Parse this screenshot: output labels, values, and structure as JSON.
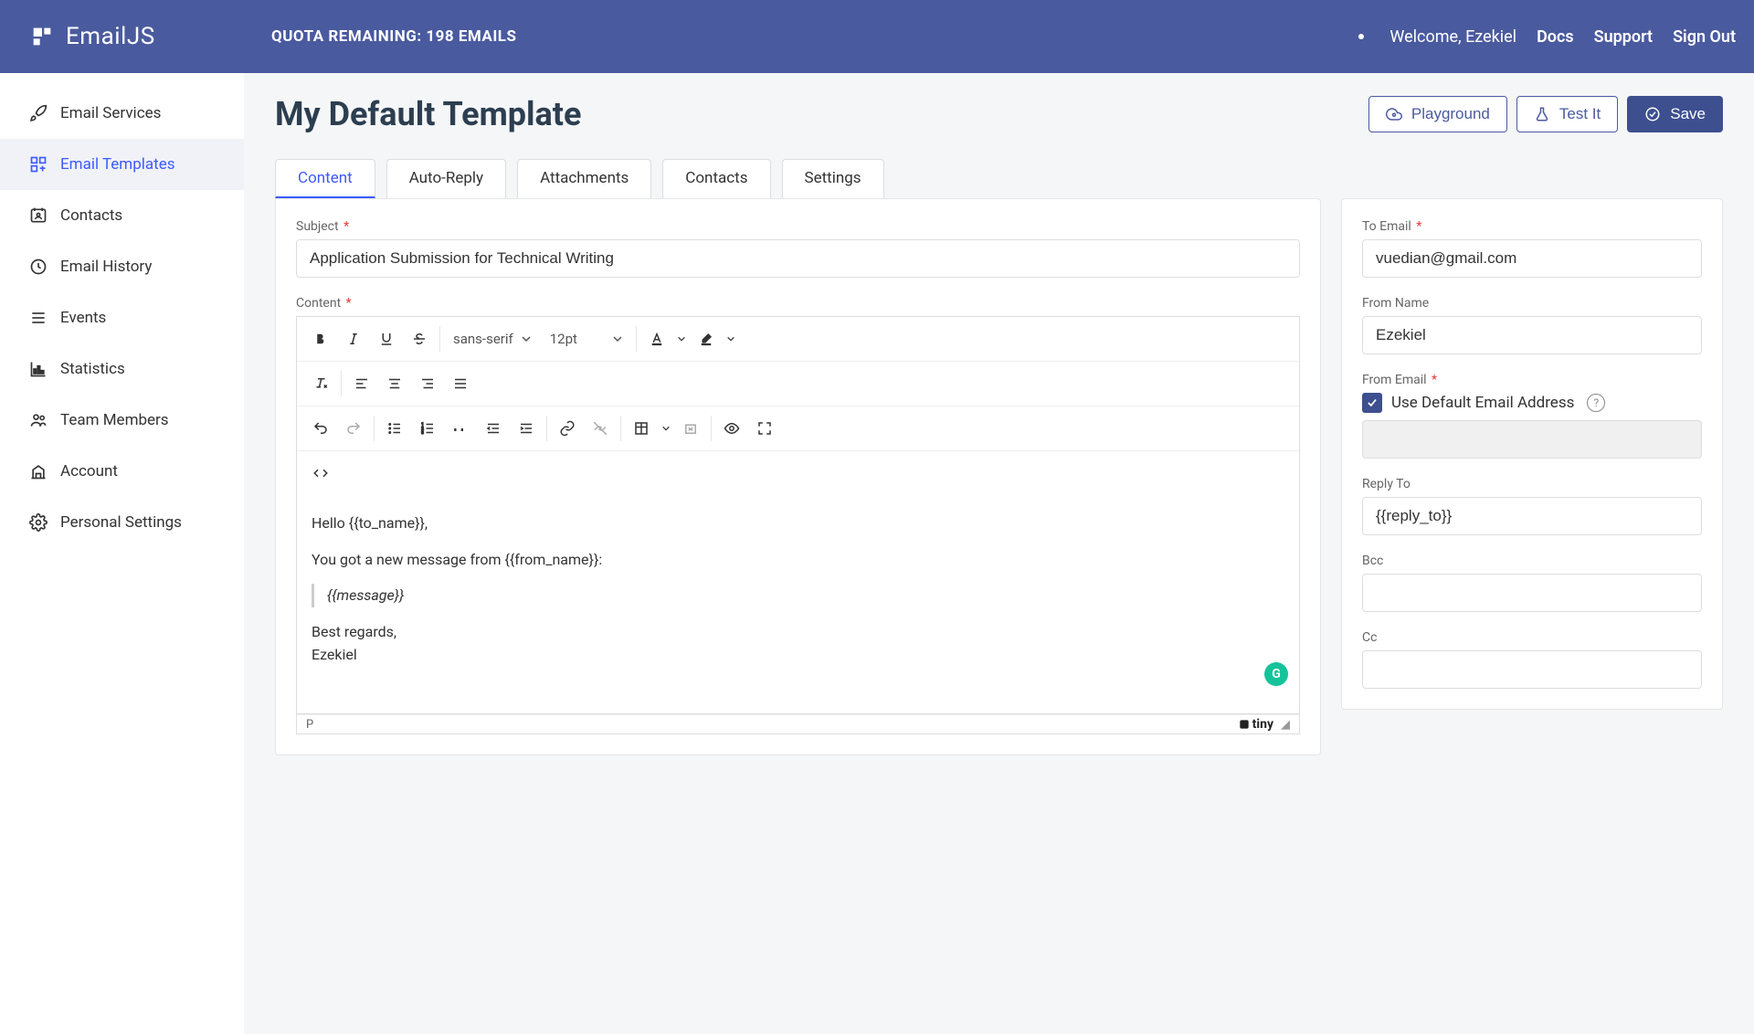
{
  "header": {
    "brand": "EmailJS",
    "quota": "QUOTA REMAINING: 198 EMAILS",
    "welcome": "Welcome,  Ezekiel",
    "links": {
      "docs": "Docs",
      "support": "Support",
      "signout": "Sign Out"
    }
  },
  "sidebar": {
    "items": [
      {
        "label": "Email Services"
      },
      {
        "label": "Email Templates"
      },
      {
        "label": "Contacts"
      },
      {
        "label": "Email History"
      },
      {
        "label": "Events"
      },
      {
        "label": "Statistics"
      },
      {
        "label": "Team Members"
      },
      {
        "label": "Account"
      },
      {
        "label": "Personal Settings"
      }
    ]
  },
  "page": {
    "title": "My Default Template",
    "actions": {
      "playground": "Playground",
      "testit": "Test It",
      "save": "Save"
    }
  },
  "tabs": [
    {
      "label": "Content"
    },
    {
      "label": "Auto-Reply"
    },
    {
      "label": "Attachments"
    },
    {
      "label": "Contacts"
    },
    {
      "label": "Settings"
    }
  ],
  "form": {
    "subject_label": "Subject",
    "subject_value": "Application Submission for Technical Writing",
    "content_label": "Content",
    "font_family": "sans-serif",
    "font_size": "12pt",
    "body": {
      "line1": "Hello {{to_name}},",
      "line2": "You got a new message from {{from_name}}:",
      "quote": "{{message}}",
      "line3a": "Best regards,",
      "line3b": "Ezekiel"
    },
    "path_indicator": "P",
    "tiny_brand": "tiny"
  },
  "right": {
    "to_email_label": "To Email",
    "to_email_value": "vuedian@gmail.com",
    "from_name_label": "From Name",
    "from_name_value": "Ezekiel",
    "from_email_label": "From Email",
    "use_default_label": "Use Default Email Address",
    "reply_to_label": "Reply To",
    "reply_to_value": "{{reply_to}}",
    "bcc_label": "Bcc",
    "cc_label": "Cc"
  }
}
